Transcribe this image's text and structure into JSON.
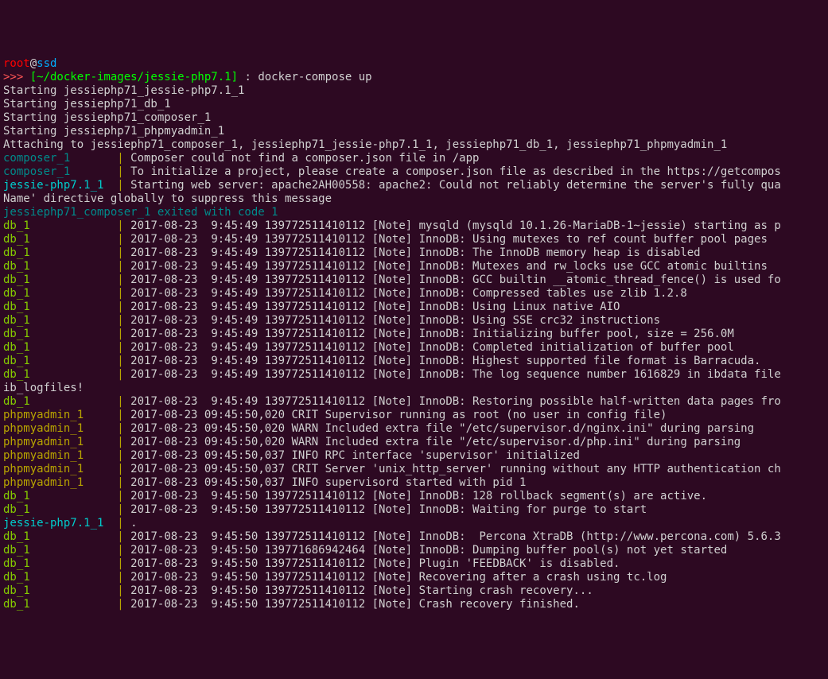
{
  "prompt": {
    "user": "root",
    "at": "@",
    "host": "ssd",
    "arrows": ">>> ",
    "path": "[~/docker-images/jessie-php7.1]",
    "colon": " : ",
    "command": "docker-compose up"
  },
  "start": [
    "Starting jessiephp71_jessie-php7.1_1",
    "Starting jessiephp71_db_1",
    "Starting jessiephp71_composer_1",
    "Starting jessiephp71_phpmyadmin_1",
    "Attaching to jessiephp71_composer_1, jessiephp71_jessie-php7.1_1, jessiephp71_db_1, jessiephp71_phpmyadmin_1"
  ],
  "exit_line_text": "jessiephp71_composer_1 exited with code 1",
  "logs": [
    {
      "svc": "composer_1",
      "color": "dkcyan",
      "type": "plain",
      "msg": "Composer could not find a composer.json file in /app"
    },
    {
      "svc": "composer_1",
      "color": "dkcyan",
      "type": "plain",
      "msg": "To initialize a project, please create a composer.json file as described in the https://getcompos"
    },
    {
      "svc": "jessie-php7.1_1",
      "color": "cyan",
      "type": "apache",
      "msg": "Starting web server: apache2AH00558: apache2: Could not reliably determine the server's fully qua",
      "cont": "Name' directive globally to suppress this message"
    },
    {
      "type": "exit"
    },
    {
      "svc": "db_1",
      "color": "green",
      "type": "db",
      "ts": "2017-08-23  9:45:49",
      "thr": "139772511410112",
      "msg": "[Note] mysqld (mysqld 10.1.26-MariaDB-1~jessie) starting as p"
    },
    {
      "svc": "db_1",
      "color": "green",
      "type": "db",
      "ts": "2017-08-23  9:45:49",
      "thr": "139772511410112",
      "msg": "[Note] InnoDB: Using mutexes to ref count buffer pool pages"
    },
    {
      "svc": "db_1",
      "color": "green",
      "type": "db",
      "ts": "2017-08-23  9:45:49",
      "thr": "139772511410112",
      "msg": "[Note] InnoDB: The InnoDB memory heap is disabled"
    },
    {
      "svc": "db_1",
      "color": "green",
      "type": "db",
      "ts": "2017-08-23  9:45:49",
      "thr": "139772511410112",
      "msg": "[Note] InnoDB: Mutexes and rw_locks use GCC atomic builtins"
    },
    {
      "svc": "db_1",
      "color": "green",
      "type": "db",
      "ts": "2017-08-23  9:45:49",
      "thr": "139772511410112",
      "msg": "[Note] InnoDB: GCC builtin __atomic_thread_fence() is used fo"
    },
    {
      "svc": "db_1",
      "color": "green",
      "type": "db",
      "ts": "2017-08-23  9:45:49",
      "thr": "139772511410112",
      "msg": "[Note] InnoDB: Compressed tables use zlib 1.2.8"
    },
    {
      "svc": "db_1",
      "color": "green",
      "type": "db",
      "ts": "2017-08-23  9:45:49",
      "thr": "139772511410112",
      "msg": "[Note] InnoDB: Using Linux native AIO"
    },
    {
      "svc": "db_1",
      "color": "green",
      "type": "db",
      "ts": "2017-08-23  9:45:49",
      "thr": "139772511410112",
      "msg": "[Note] InnoDB: Using SSE crc32 instructions"
    },
    {
      "svc": "db_1",
      "color": "green",
      "type": "db",
      "ts": "2017-08-23  9:45:49",
      "thr": "139772511410112",
      "msg": "[Note] InnoDB: Initializing buffer pool, size = 256.0M"
    },
    {
      "svc": "db_1",
      "color": "green",
      "type": "db",
      "ts": "2017-08-23  9:45:49",
      "thr": "139772511410112",
      "msg": "[Note] InnoDB: Completed initialization of buffer pool"
    },
    {
      "svc": "db_1",
      "color": "green",
      "type": "db",
      "ts": "2017-08-23  9:45:49",
      "thr": "139772511410112",
      "msg": "[Note] InnoDB: Highest supported file format is Barracuda."
    },
    {
      "svc": "db_1",
      "color": "green",
      "type": "db",
      "ts": "2017-08-23  9:45:49",
      "thr": "139772511410112",
      "msg": "[Note] InnoDB: The log sequence number 1616829 in ibdata file",
      "cont": "ib_logfiles!"
    },
    {
      "svc": "db_1",
      "color": "green",
      "type": "db",
      "ts": "2017-08-23  9:45:49",
      "thr": "139772511410112",
      "msg": "[Note] InnoDB: Restoring possible half-written data pages fro"
    },
    {
      "svc": "phpmyadmin_1",
      "color": "yellow",
      "type": "pma",
      "ts": "2017-08-23 09:45:50,020",
      "msg": "CRIT Supervisor running as root (no user in config file)"
    },
    {
      "svc": "phpmyadmin_1",
      "color": "yellow",
      "type": "pma",
      "ts": "2017-08-23 09:45:50,020",
      "msg": "WARN Included extra file \"/etc/supervisor.d/nginx.ini\" during parsing"
    },
    {
      "svc": "phpmyadmin_1",
      "color": "yellow",
      "type": "pma",
      "ts": "2017-08-23 09:45:50,020",
      "msg": "WARN Included extra file \"/etc/supervisor.d/php.ini\" during parsing"
    },
    {
      "svc": "phpmyadmin_1",
      "color": "yellow",
      "type": "pma",
      "ts": "2017-08-23 09:45:50,037",
      "msg": "INFO RPC interface 'supervisor' initialized"
    },
    {
      "svc": "phpmyadmin_1",
      "color": "yellow",
      "type": "pma",
      "ts": "2017-08-23 09:45:50,037",
      "msg": "CRIT Server 'unix_http_server' running without any HTTP authentication ch"
    },
    {
      "svc": "phpmyadmin_1",
      "color": "yellow",
      "type": "pma",
      "ts": "2017-08-23 09:45:50,037",
      "msg": "INFO supervisord started with pid 1"
    },
    {
      "svc": "db_1",
      "color": "green",
      "type": "db",
      "ts": "2017-08-23  9:45:50",
      "thr": "139772511410112",
      "msg": "[Note] InnoDB: 128 rollback segment(s) are active."
    },
    {
      "svc": "db_1",
      "color": "green",
      "type": "db",
      "ts": "2017-08-23  9:45:50",
      "thr": "139772511410112",
      "msg": "[Note] InnoDB: Waiting for purge to start"
    },
    {
      "svc": "jessie-php7.1_1",
      "color": "cyan",
      "type": "plain",
      "msg": "."
    },
    {
      "svc": "db_1",
      "color": "green",
      "type": "db",
      "ts": "2017-08-23  9:45:50",
      "thr": "139772511410112",
      "msg": "[Note] InnoDB:  Percona XtraDB (http://www.percona.com) 5.6.3"
    },
    {
      "svc": "db_1",
      "color": "green",
      "type": "db",
      "ts": "2017-08-23  9:45:50",
      "thr": "139771686942464",
      "msg": "[Note] InnoDB: Dumping buffer pool(s) not yet started"
    },
    {
      "svc": "db_1",
      "color": "green",
      "type": "db",
      "ts": "2017-08-23  9:45:50",
      "thr": "139772511410112",
      "msg": "[Note] Plugin 'FEEDBACK' is disabled."
    },
    {
      "svc": "db_1",
      "color": "green",
      "type": "db",
      "ts": "2017-08-23  9:45:50",
      "thr": "139772511410112",
      "msg": "[Note] Recovering after a crash using tc.log"
    },
    {
      "svc": "db_1",
      "color": "green",
      "type": "db",
      "ts": "2017-08-23  9:45:50",
      "thr": "139772511410112",
      "msg": "[Note] Starting crash recovery..."
    },
    {
      "svc": "db_1",
      "color": "green",
      "type": "db",
      "ts": "2017-08-23  9:45:50",
      "thr": "139772511410112",
      "msg": "[Note] Crash recovery finished."
    }
  ]
}
